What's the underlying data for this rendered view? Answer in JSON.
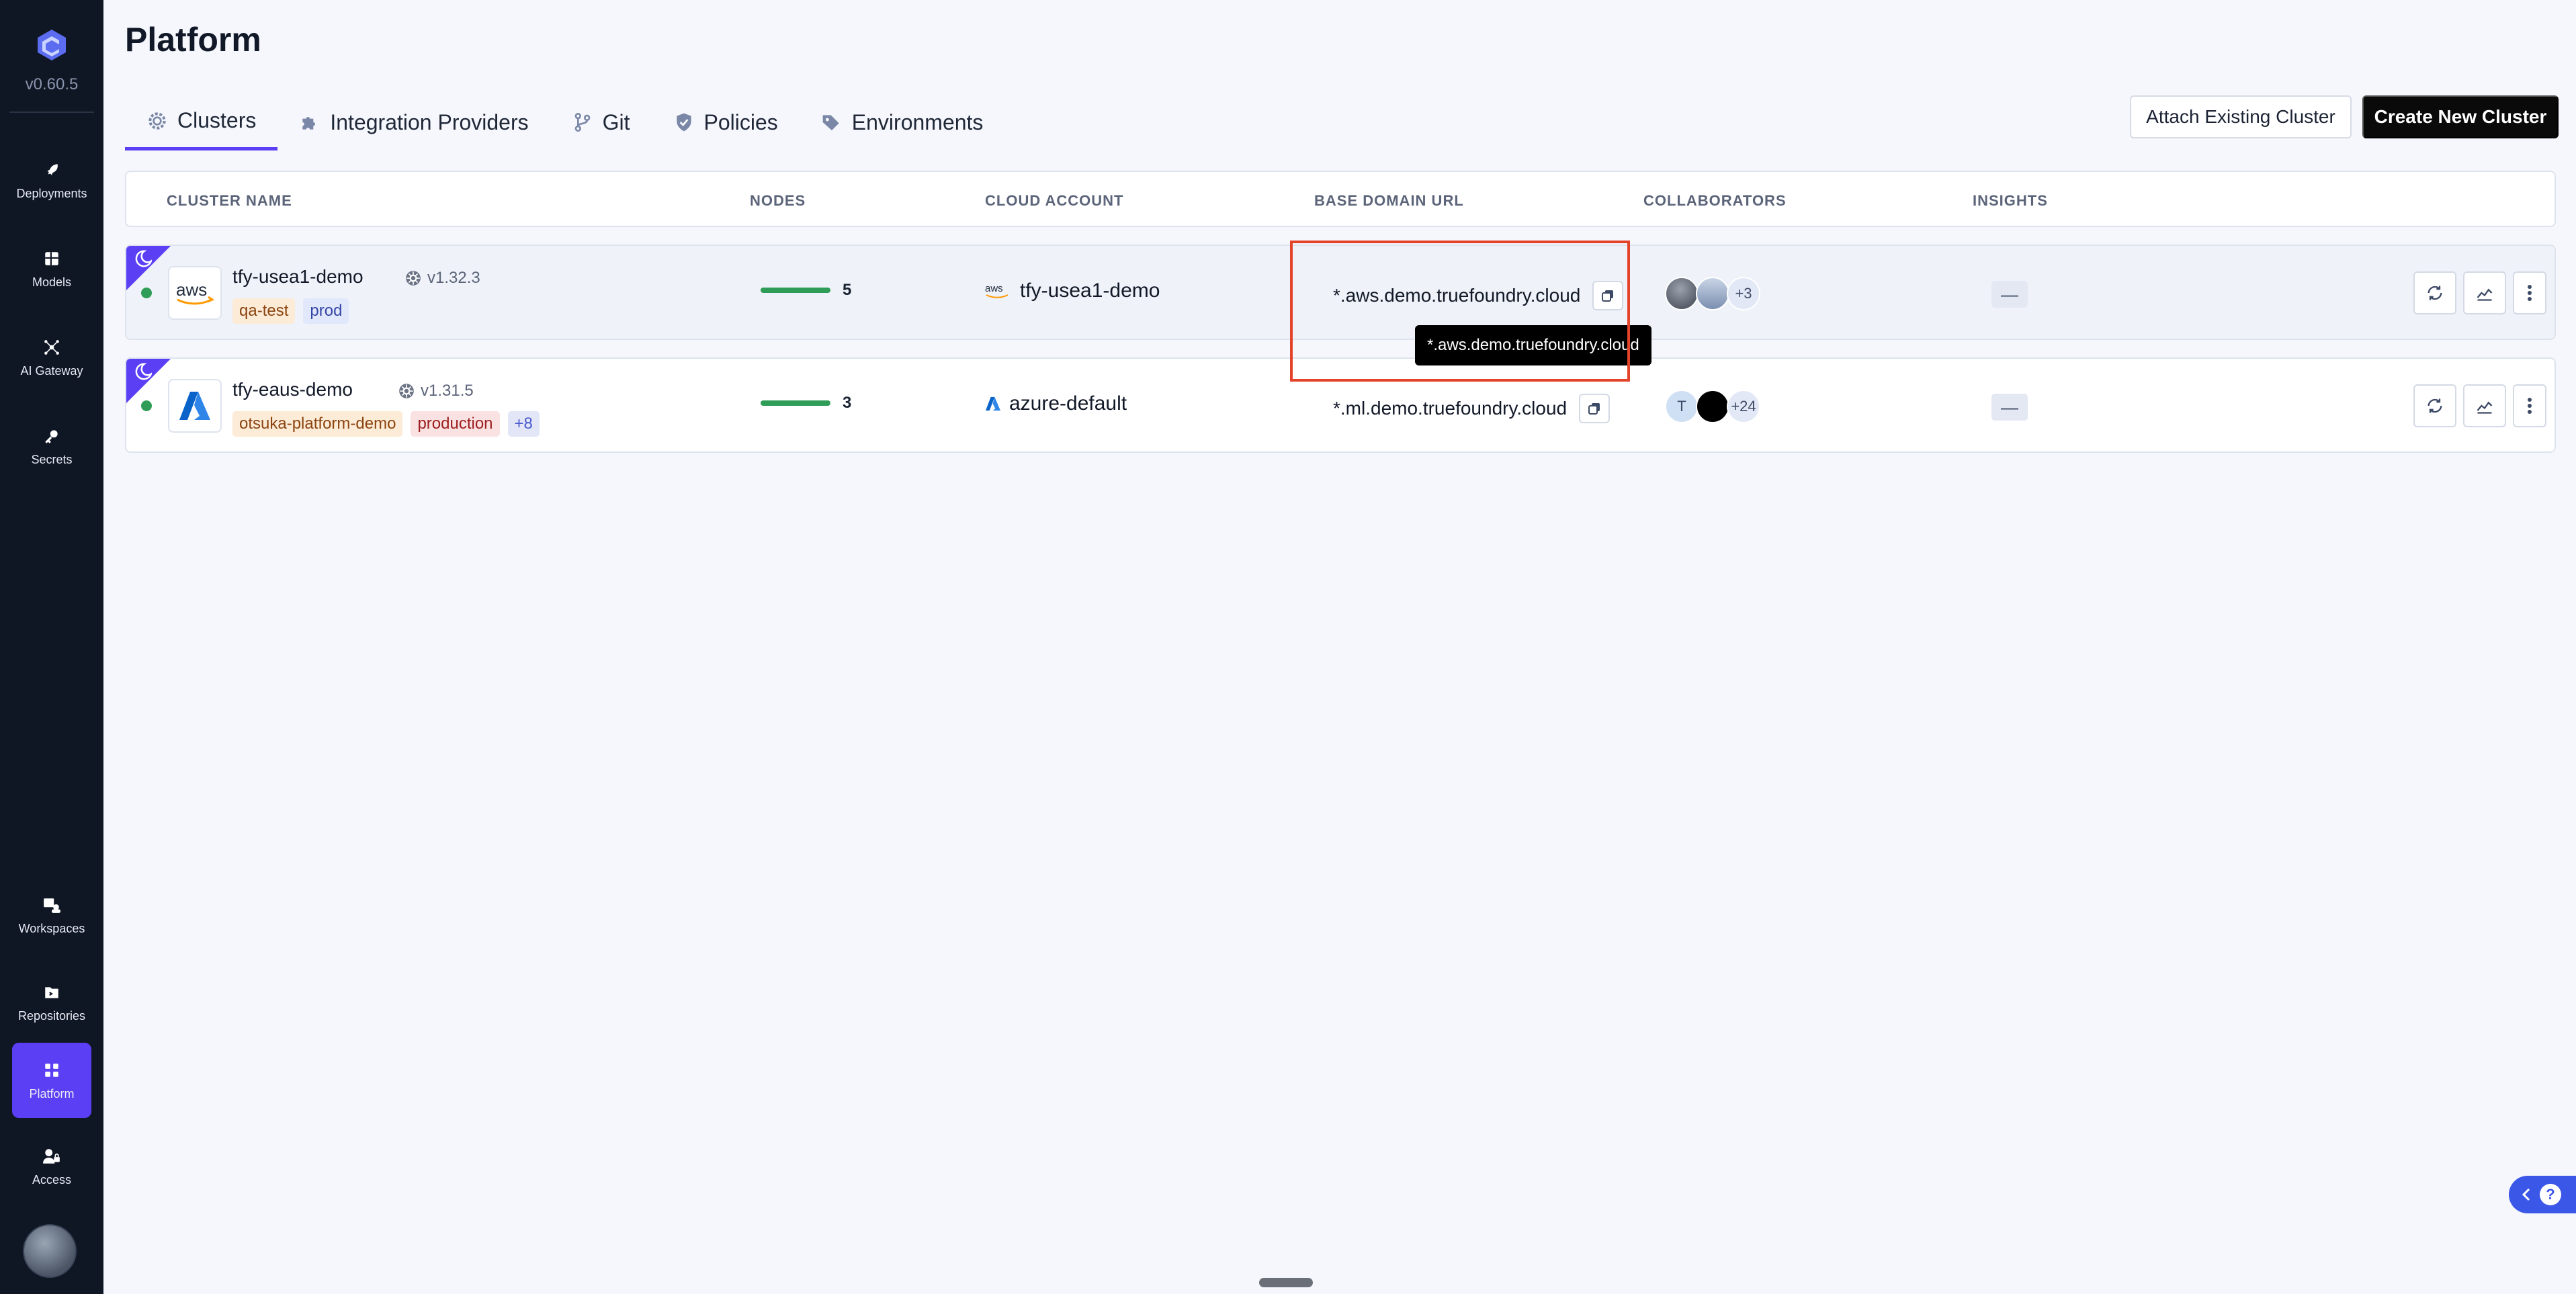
{
  "sidebar": {
    "version": "v0.60.5",
    "top_items": [
      {
        "label": "Deployments",
        "icon": "rocket-icon"
      },
      {
        "label": "Models",
        "icon": "grid-icon"
      },
      {
        "label": "AI Gateway",
        "icon": "gateway-icon"
      },
      {
        "label": "Secrets",
        "icon": "key-icon"
      }
    ],
    "bottom_items": [
      {
        "label": "Workspaces",
        "icon": "workspaces-icon"
      },
      {
        "label": "Repositories",
        "icon": "repository-icon"
      },
      {
        "label": "Platform",
        "icon": "platform-icon",
        "active": true
      },
      {
        "label": "Access",
        "icon": "user-lock-icon"
      }
    ],
    "active_color": "#5b3ff5"
  },
  "page": {
    "title": "Platform"
  },
  "tabs": [
    {
      "label": "Clusters",
      "icon": "gear-icon",
      "active": true
    },
    {
      "label": "Integration Providers",
      "icon": "puzzle-icon"
    },
    {
      "label": "Git",
      "icon": "git-branch-icon"
    },
    {
      "label": "Policies",
      "icon": "shield-icon"
    },
    {
      "label": "Environments",
      "icon": "tags-icon"
    }
  ],
  "buttons": {
    "attach": "Attach Existing Cluster",
    "create": "Create New Cluster"
  },
  "table": {
    "headers": [
      "CLUSTER NAME",
      "NODES",
      "CLOUD ACCOUNT",
      "BASE DOMAIN URL",
      "COLLABORATORS",
      "INSIGHTS"
    ],
    "rows": [
      {
        "provider": "aws",
        "name": "tfy-usea1-demo",
        "k8s_version": "v1.32.3",
        "tags": [
          "qa-test",
          "prod"
        ],
        "nodes": "5",
        "cloud_account": "tfy-usea1-demo",
        "base_domain": "*.aws.demo.truefoundry.cloud",
        "collaborators_more": "+3",
        "insights": "—",
        "status": "running"
      },
      {
        "provider": "azure",
        "name": "tfy-eaus-demo",
        "k8s_version": "v1.31.5",
        "tags": [
          "otsuka-platform-demo",
          "production",
          "+8"
        ],
        "nodes": "3",
        "cloud_account": "azure-default",
        "base_domain": "*.ml.demo.truefoundry.cloud",
        "collaborator_initial": "T",
        "collaborators_more": "+24",
        "insights": "—",
        "status": "running"
      }
    ]
  },
  "tooltip": "*.aws.demo.truefoundry.cloud",
  "colors": {
    "accent": "#5b3ff5",
    "status_ok": "#2f9d57",
    "highlight": "#e2432a",
    "help": "#3b57e8"
  }
}
